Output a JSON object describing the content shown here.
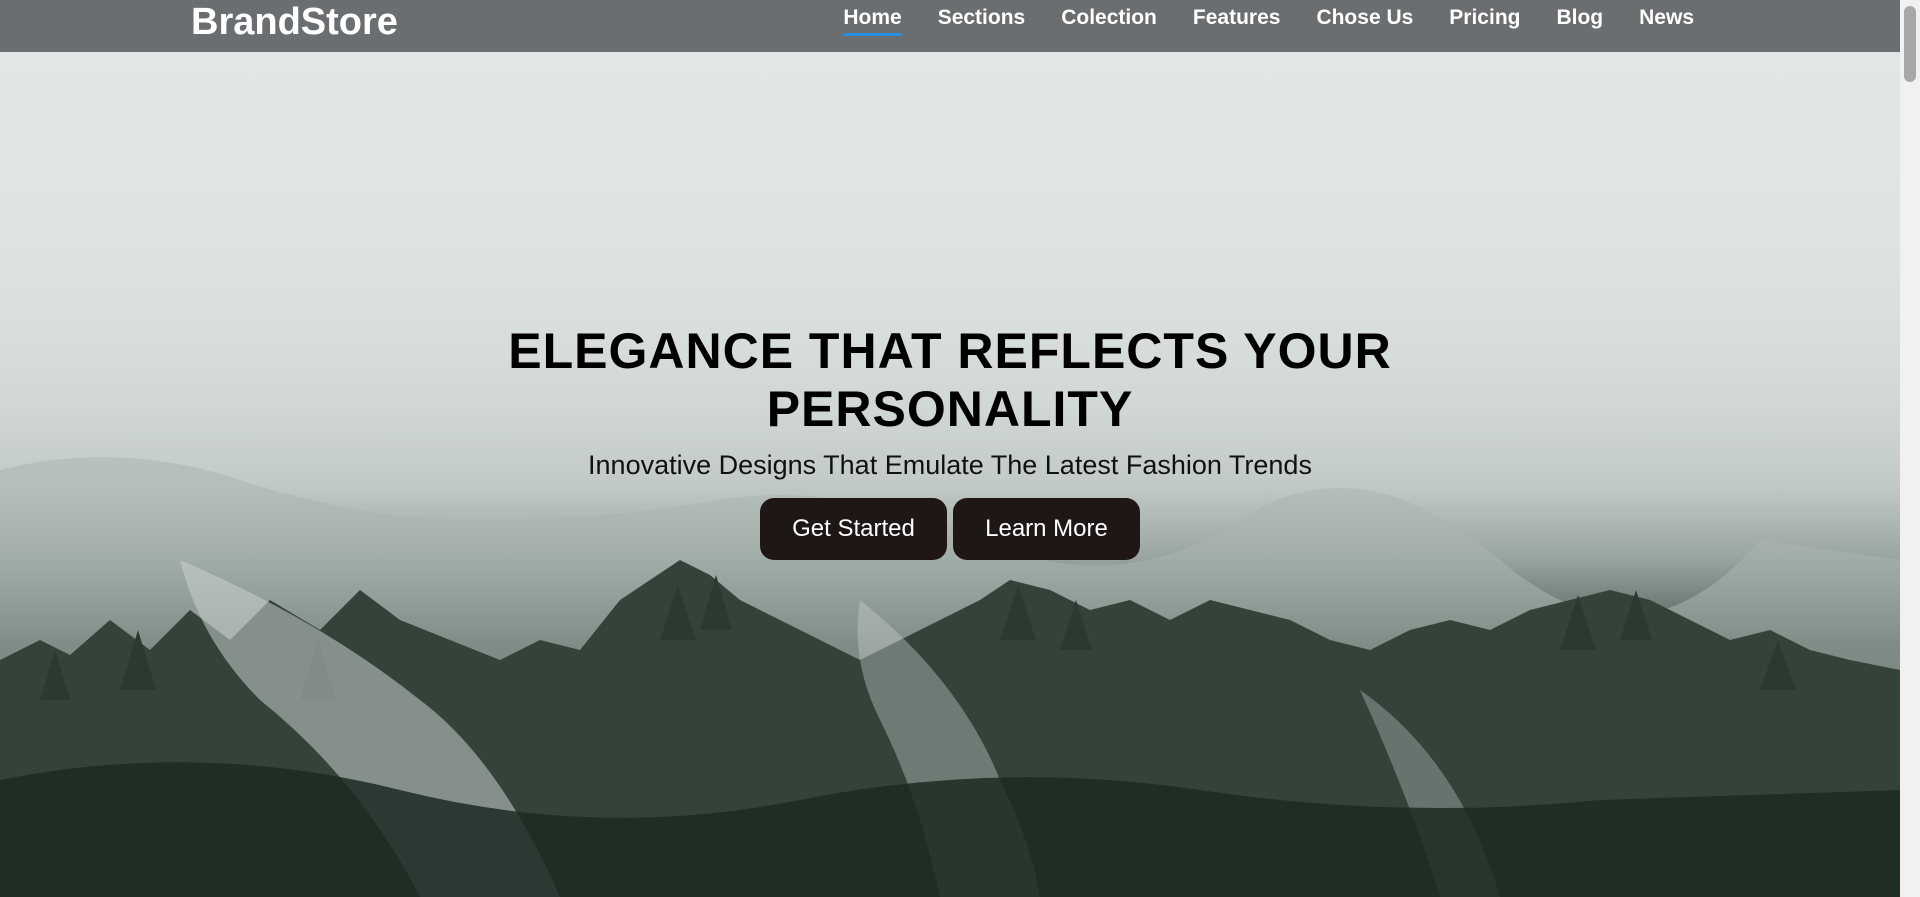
{
  "brand": {
    "name": "BrandStore"
  },
  "nav": {
    "items": [
      {
        "label": "Home",
        "active": true
      },
      {
        "label": "Sections",
        "active": false
      },
      {
        "label": "Colection",
        "active": false
      },
      {
        "label": "Features",
        "active": false
      },
      {
        "label": "Chose Us",
        "active": false
      },
      {
        "label": "Pricing",
        "active": false
      },
      {
        "label": "Blog",
        "active": false
      },
      {
        "label": "News",
        "active": false
      }
    ],
    "active_underline_color": "#2a8fe0"
  },
  "hero": {
    "title": "ELEGANCE THAT REFLECTS YOUR PERSONALITY",
    "subtitle": "Innovative Designs That Emulate The Latest Fashion Trends",
    "background": "foggy-forest-image",
    "buttons": {
      "primary_label": "Get Started",
      "secondary_label": "Learn More"
    },
    "button_color": "#1f1716"
  }
}
